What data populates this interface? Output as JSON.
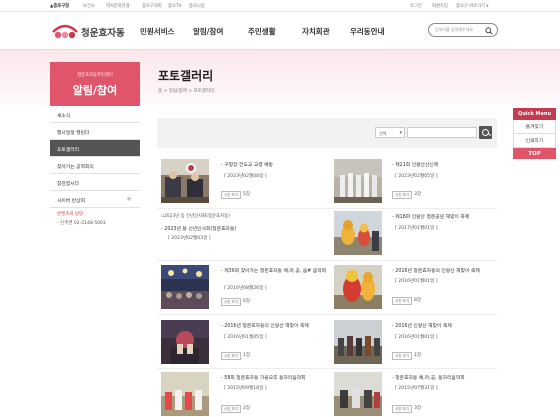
{
  "topbar": {
    "home": "종로구청",
    "links": [
      "보건소",
      "역사문화관광",
      "종로구의회",
      "종로TV",
      "종로시장"
    ],
    "login": "로그인",
    "join": "회원가입",
    "district": "종로구 바로가기"
  },
  "header": {
    "site_title": "청운효자동",
    "gnb": [
      "민원서비스",
      "알림/참여",
      "주민생활",
      "자치회관",
      "우리동안내"
    ],
    "search_placeholder": "검색어를 입력해주세요"
  },
  "lnb": {
    "subtitle": "청운효자동주민센터",
    "title": "알림/참여"
  },
  "sidebar": {
    "items": [
      {
        "label": "새소식"
      },
      {
        "label": "행사일정 캘린더"
      },
      {
        "label": "포토갤러리"
      },
      {
        "label": "찾아가는 공력회의"
      },
      {
        "label": "칭찬합시다"
      },
      {
        "label": "사이버 반상회"
      }
    ],
    "active": "포토갤러리",
    "contact_label": "콘텐츠이 담당",
    "contact_number": "- 신주연 02-2148-5003"
  },
  "page": {
    "title": "포토갤러리",
    "breadcrumb": [
      "홈",
      "알림/참여",
      "포토갤러리"
    ]
  },
  "filter": {
    "select_label": "선택"
  },
  "gallery": [
    {
      "title": "구청장 전도교 교령 예방",
      "date": "[ 2023년02월08일 ]",
      "views_label": "사진 보기",
      "views": "5장"
    },
    {
      "title": "제21회 인왕산산신제",
      "date": "[ 2023년02월05일 ]",
      "views_label": "사진 보기",
      "views": "3장"
    },
    {
      "title": "2023년 동 신년인사회(청운효자동)",
      "date": "[ 2023년02월03일 ]",
      "alt": "2023년 동 신년인사회(청운효자동)"
    },
    {
      "title": "제18회 인왕산 청운공원 해맞이 축제",
      "date": "[ 2017년01월01일 ]"
    },
    {
      "title": "제36회 찾아가는 청운효자동 예,마,공, 음# 음악회",
      "date": "[ 2016년08월26일 ]",
      "views_label": "사진 보기",
      "views": "6장"
    },
    {
      "title": "2016년 청운효자동의 인왕산 해맞이 축제",
      "date": "[ 2016년01월01일 ]",
      "views_label": "사진 보기",
      "views": "8장"
    },
    {
      "title": "2016년 청운효자동의 인왕산 해맞이 축제",
      "date": "[ 2016년01월05일 ]",
      "views_label": "사진 보기",
      "views": "1장"
    },
    {
      "title": "2016년 인왕산 해맞이 축제",
      "date": "[ 2016년01월01일 ]",
      "views_label": "사진 보기",
      "views": "1장"
    },
    {
      "title": "58회 청운효자동 가을오후 동자리음악회",
      "date": "[ 2015년09월18일 ]",
      "views_label": "사진 보기",
      "views": "2장"
    },
    {
      "title": "청운효자동 예,마,공, 동자리음악회",
      "date": "[ 2015년07월31일 ]",
      "views_label": "사진 보기",
      "views": "3장"
    }
  ],
  "quick_menu": {
    "title": "Quick Menu",
    "items": [
      "즐겨찾기",
      "인쇄하기"
    ],
    "top": "TOP"
  },
  "colors": {
    "accent": "#e0556a",
    "quick": "#c63a4e",
    "active_side": "#555555"
  }
}
